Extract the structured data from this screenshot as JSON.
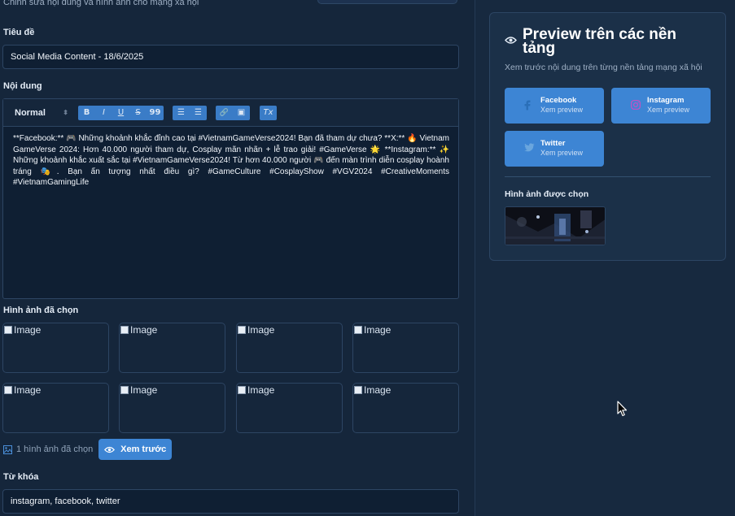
{
  "header": {
    "subtitle": "Chỉnh sửa nội dung và hình ảnh cho mạng xã hội"
  },
  "form": {
    "title_label": "Tiêu đề",
    "title_value": "Social Media Content - 18/6/2025",
    "content_label": "Nội dung",
    "editor": {
      "format_select": "Normal",
      "toolbar_buttons": [
        "bold",
        "italic",
        "underline",
        "strike",
        "blockquote",
        "ordered-list",
        "bullet-list",
        "link",
        "image",
        "clean-format"
      ],
      "toolbar_glyphs": {
        "bold": "B",
        "italic": "I",
        "underline": "U",
        "strike": "S",
        "blockquote": "99",
        "ordered_list": "☰",
        "bullet_list": "☰",
        "link": "🔗",
        "image": "▣",
        "clean": "Tx"
      },
      "text": "**Facebook:** 🎮 Những khoảnh khắc đỉnh cao tại #VietnamGameVerse2024! Bạn đã tham dự chưa? **X:** 🔥 Vietnam GameVerse 2024: Hơn 40.000 người tham dự, Cosplay mãn nhãn + lễ trao giải! #GameVerse 🌟 **Instagram:** ✨ Những khoảnh khắc xuất sắc tại #VietnamGameVerse2024! Từ hơn 40.000 người 🎮 đến màn trình diễn cosplay hoành tráng 🎭. Bạn ấn tượng nhất điều gì? #GameCulture #CosplayShow #VGV2024 #CreativeMoments #VietnamGamingLife"
    },
    "images_label": "Hình ảnh đã chọn",
    "images": [
      "Image",
      "Image",
      "Image",
      "Image",
      "Image",
      "Image",
      "Image",
      "Image"
    ],
    "images_count_text": "1 hình ảnh đã chọn",
    "preview_button": "Xem trước",
    "keywords_label": "Từ khóa",
    "keywords_value": "instagram, facebook, twitter"
  },
  "preview_panel": {
    "title": "Preview trên các nền tảng",
    "subtitle": "Xem trước nội dung trên từng nền tảng mạng xã hội",
    "platforms": [
      {
        "name": "Facebook",
        "action": "Xem preview",
        "icon": "facebook-icon"
      },
      {
        "name": "Instagram",
        "action": "Xem preview",
        "icon": "instagram-icon"
      },
      {
        "name": "Twitter",
        "action": "Xem preview",
        "icon": "twitter-icon"
      }
    ],
    "selected_image_label": "Hình ảnh được chọn"
  },
  "colors": {
    "background": "#17293f",
    "panel": "#1b3048",
    "accent": "#3d85d4"
  }
}
